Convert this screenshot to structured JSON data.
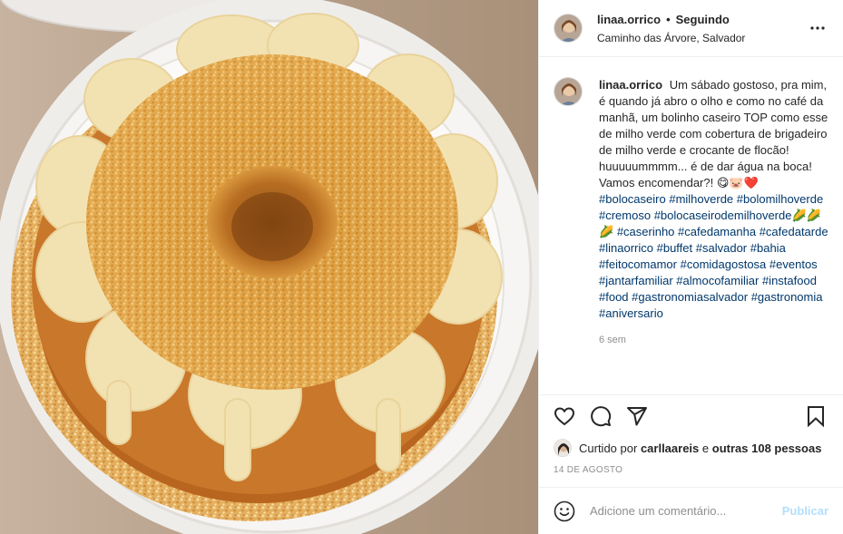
{
  "header": {
    "username": "linaa.orrico",
    "separator": "•",
    "follow_status": "Seguindo",
    "location": "Caminho das Árvore, Salvador",
    "more_icon": "more-horizontal-icon"
  },
  "caption": {
    "username": "linaa.orrico",
    "text": "Um sábado gostoso, pra mim, é quando já abro o olho e como no café da manhã, um bolinho caseiro TOP como esse de milho verde com cobertura de brigadeiro de milho verde e crocante de flocão! huuuuummmm... é de dar água na boca! Vamos encomendar?! 😋🐷❤️",
    "hashtags": [
      "#bolocaseiro",
      "#milhoverde",
      "#bolomilhoverde",
      "#cremoso",
      "#bolocaseirodemilhoverde🌽🌽🌽",
      "#caserinho",
      "#cafedamanha",
      "#cafedatarde",
      "#linaorrico",
      "#buffet",
      "#salvador",
      "#bahia",
      "#feitocomamor",
      "#comidagostosa",
      "#eventos",
      "#jantarfamiliar",
      "#almocofamiliar",
      "#instafood",
      "#food",
      "#gastronomiasalvador",
      "#gastronomia",
      "#aniversario"
    ],
    "time_ago": "6 sem"
  },
  "actions": {
    "like_icon": "heart-icon",
    "comment_icon": "comment-icon",
    "share_icon": "share-icon",
    "save_icon": "bookmark-icon"
  },
  "likes": {
    "prefix": "Curtido por",
    "user": "carllaareis",
    "conjunction": "e",
    "others": "outras 108 pessoas"
  },
  "date": "14 DE AGOSTO",
  "add_comment": {
    "placeholder": "Adicione um comentário...",
    "publish_label": "Publicar",
    "emoji_icon": "smiley-icon"
  },
  "colors": {
    "link": "#00376b",
    "muted": "#8e8e8e",
    "publish_disabled": "#b2dffc",
    "border": "#efefef"
  }
}
